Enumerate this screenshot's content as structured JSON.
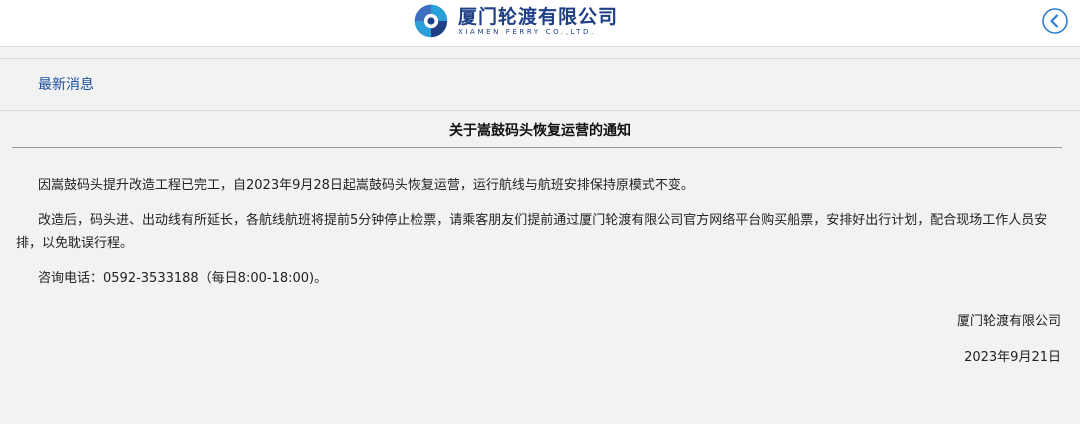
{
  "header": {
    "company_cn": "厦门轮渡有限公司",
    "company_en": "XIAMEN FERRY CO.,LTD.",
    "logo_icon": "ferry-logo-icon",
    "back_icon": "back-circle-icon"
  },
  "section": {
    "title": "最新消息"
  },
  "article": {
    "title": "关于嵩鼓码头恢复运营的通知",
    "paragraphs": [
      "因嵩鼓码头提升改造工程已完工，自2023年9月28日起嵩鼓码头恢复运营，运行航线与航班安排保持原模式不变。",
      "改造后，码头进、出动线有所延长，各航线航班将提前5分钟停止检票，请乘客朋友们提前通过厦门轮渡有限公司官方网络平台购买船票，安排好出行计划，配合现场工作人员安排，以免耽误行程。",
      "咨询电话：0592-3533188（每日8:00-18:00)。"
    ],
    "signature": "厦门轮渡有限公司",
    "date": "2023年9月21日"
  },
  "colors": {
    "brand_blue": "#1f3f86",
    "link_blue": "#1a4f9e",
    "page_bg": "#f2f2f2"
  }
}
